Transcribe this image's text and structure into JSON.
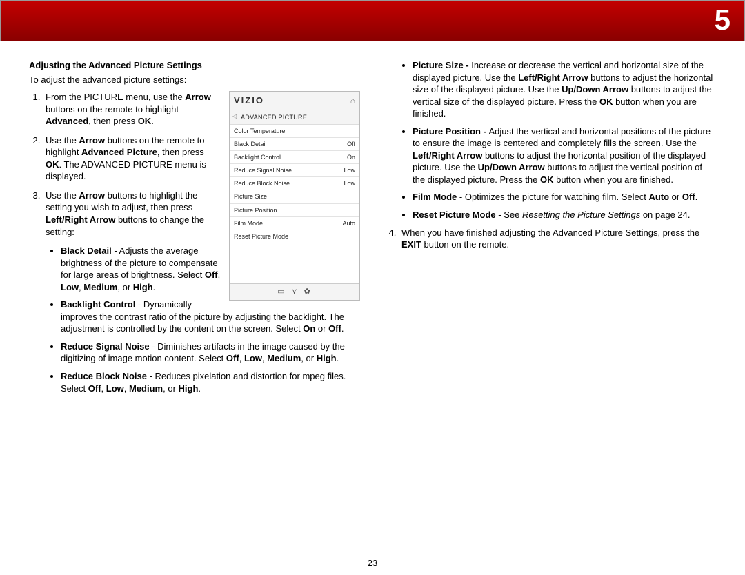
{
  "chapter_number": "5",
  "page_number": "23",
  "left": {
    "heading": "Adjusting the Advanced Picture Settings",
    "intro": "To adjust the advanced picture settings:",
    "step1_a": "From the PICTURE menu, use the ",
    "step1_b": "Arrow",
    "step1_c": " buttons on the remote to highlight ",
    "step1_d": "Advanced",
    "step1_e": ", then press ",
    "step1_f": "OK",
    "step1_g": ".",
    "step2_a": "Use the ",
    "step2_b": "Arrow",
    "step2_c": " buttons on the remote to highlight ",
    "step2_d": "Advanced Picture",
    "step2_e": ", then press ",
    "step2_f": "OK",
    "step2_g": ". The ADVANCED PICTURE menu is displayed.",
    "step3_a": "Use the ",
    "step3_b": "Arrow",
    "step3_c": " buttons to highlight the setting you wish to adjust, then press ",
    "step3_d": "Left/Right Arrow",
    "step3_e": " buttons to change the setting:",
    "bd_t": "Black Detail",
    "bd_r": " - Adjusts the average brightness of the picture to compensate for large areas of brightness. Select ",
    "bd_o1": "Off",
    "bd_c1": ", ",
    "bd_o2": "Low",
    "bd_c2": ", ",
    "bd_o3": "Medium",
    "bd_c3": ", or ",
    "bd_o4": "High",
    "bd_end": ".",
    "bc_t": "Backlight Control",
    "bc_r": " - Dynamically improves the contrast ratio of the picture by adjusting the backlight. The adjustment is controlled by the content on the screen. Select ",
    "bc_o1": "On",
    "bc_c1": " or ",
    "bc_o2": "Off",
    "bc_end": ".",
    "rs_t": "Reduce Signal Noise",
    "rs_r": " - Diminishes artifacts in the image caused by the digitizing of image motion content. Select ",
    "rs_o1": "Off",
    "rs_c1": ", ",
    "rs_o2": "Low",
    "rs_c2": ", ",
    "rs_o3": "Medium",
    "rs_c3": ", or ",
    "rs_o4": "High",
    "rs_end": ".",
    "rb_t": "Reduce Block Noise",
    "rb_r": " - Reduces pixelation and distortion for mpeg files. Select ",
    "rb_o1": "Off",
    "rb_c1": ", ",
    "rb_o2": "Low",
    "rb_c2": ", ",
    "rb_o3": "Medium",
    "rb_c3": ", or ",
    "rb_o4": "High",
    "rb_end": "."
  },
  "menu": {
    "logo": "VIZIO",
    "title": "ADVANCED PICTURE",
    "rows": [
      {
        "l": "Color Temperature",
        "v": ""
      },
      {
        "l": "Black Detail",
        "v": "Off"
      },
      {
        "l": "Backlight Control",
        "v": "On"
      },
      {
        "l": "Reduce Signal Noise",
        "v": "Low"
      },
      {
        "l": "Reduce Block Noise",
        "v": "Low"
      },
      {
        "l": "Picture Size",
        "v": ""
      },
      {
        "l": "Picture Position",
        "v": ""
      },
      {
        "l": "Film Mode",
        "v": "Auto"
      },
      {
        "l": "Reset Picture Mode",
        "v": ""
      }
    ],
    "foot1": "▭",
    "foot2": "⋎",
    "foot3": "✿"
  },
  "right": {
    "ps_t": "Picture Size - ",
    "ps_a": "Increase or decrease the vertical and horizontal size of the displayed picture. Use the ",
    "ps_b": "Left/Right Arrow",
    "ps_c": " buttons to adjust the horizontal size of the displayed picture. Use the ",
    "ps_d": "Up/Down Arrow",
    "ps_e": " buttons to adjust the vertical size of the displayed picture. Press the ",
    "ps_f": "OK",
    "ps_g": " button when you are finished.",
    "pp_t": "Picture Position - ",
    "pp_a": "Adjust the vertical and horizontal positions of the picture to ensure the image is centered and completely fills the screen. Use the ",
    "pp_b": "Left/Right Arrow",
    "pp_c": " buttons to adjust the horizontal position of the displayed picture. Use the ",
    "pp_d": "Up/Down Arrow",
    "pp_e": " buttons to adjust the vertical position of the displayed picture. Press the ",
    "pp_f": "OK",
    "pp_g": " button when you are finished.",
    "fm_t": "Film Mode",
    "fm_a": " - Optimizes the picture for watching film. Select ",
    "fm_b": "Auto",
    "fm_c": " or ",
    "fm_d": "Off",
    "fm_e": ".",
    "rp_t": "Reset Picture Mode",
    "rp_a": " - See ",
    "rp_b": "Resetting the Picture Settings",
    "rp_c": " on page 24.",
    "step4_a": "When you have finished adjusting the Advanced Picture Settings, press the ",
    "step4_b": "EXIT",
    "step4_c": " button on the remote."
  }
}
